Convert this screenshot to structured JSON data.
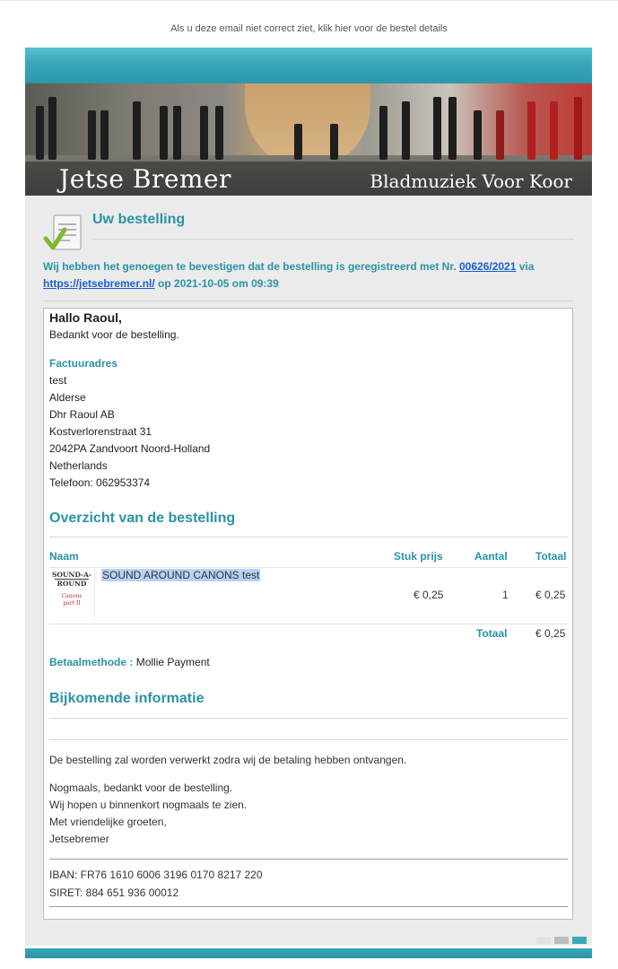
{
  "preheader": {
    "text": "Als u deze email niet correct ziet, klik hier voor de bestel details"
  },
  "banner": {
    "brand": "Jetse Bremer",
    "tagline": "Bladmuziek Voor Koor"
  },
  "order": {
    "title": "Uw bestelling",
    "confirm_prefix": "Wij hebben het genoegen te bevestigen dat de bestelling is geregistreerd met Nr. ",
    "order_number": "00626/2021",
    "confirm_via": " via",
    "site_url": "https://jetsebremer.nl/",
    "confirm_date": " op 2021-10-05 om 09:39"
  },
  "greeting": "Hallo Raoul,",
  "thanks": "Bedankt voor de bestelling.",
  "billing": {
    "label": "Factuuradres",
    "lines": [
      "test",
      "Alderse",
      "Dhr Raoul AB",
      "Kostverlorenstraat 31",
      "2042PA Zandvoort Noord-Holland",
      "Netherlands",
      "Telefoon: 062953374"
    ]
  },
  "overview": {
    "title": "Overzicht van de bestelling",
    "headers": {
      "name": "Naam",
      "unit_price": "Stuk prijs",
      "qty": "Aantal",
      "total": "Totaal"
    },
    "item": {
      "thumb_line1": "SOUND-A-",
      "thumb_line2": "ROUND",
      "thumb_sub1": "Canons",
      "thumb_sub2": "part II",
      "name": "SOUND AROUND CANONS test",
      "unit_price": "€ 0,25",
      "qty": "1",
      "total": "€ 0,25"
    },
    "total_label": "Totaal",
    "total_value": "€ 0,25"
  },
  "payment": {
    "label": "Betaalmethode :",
    "value": " Mollie Payment"
  },
  "extra": {
    "title": "Bijkomende informatie",
    "processing": "De bestelling zal worden verwerkt zodra wij de betaling hebben ontvangen.",
    "closing": [
      "Nogmaals, bedankt voor de bestelling.",
      "Wij hopen u binnenkort nogmaals te zien.",
      "Met vriendelijke groeten,",
      "Jetsebremer"
    ]
  },
  "bank": {
    "iban": "IBAN: FR76 1610 6006 3196 0170 8217 220",
    "siret": "SIRET: 884 651 936 00012"
  },
  "colors": {
    "accent": "#2a93a6",
    "link": "#1a5fd0",
    "panel": "#ebebeb"
  }
}
